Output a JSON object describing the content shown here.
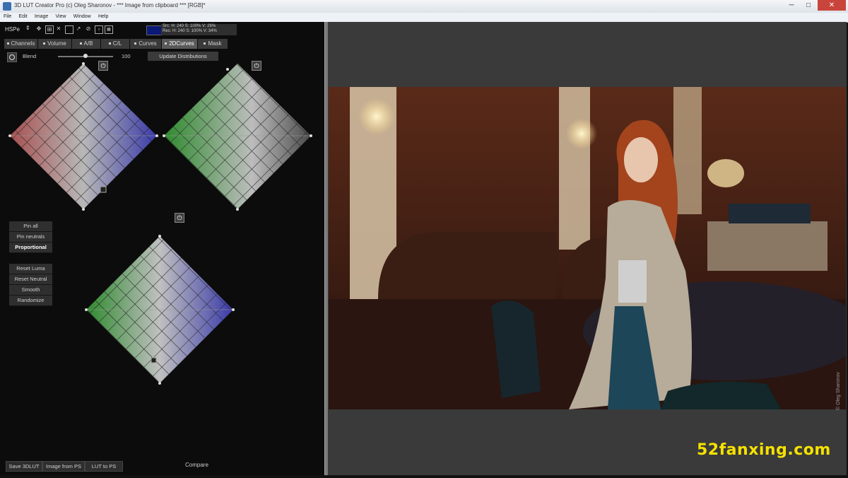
{
  "window": {
    "title": "3D LUT Creator Pro (c) Oleg Sharonov - *** Image from clipboard *** [RGB]*",
    "controls": {
      "minimize": "─",
      "maximize": "□",
      "close": "✕"
    }
  },
  "menu": [
    "File",
    "Edit",
    "Image",
    "View",
    "Window",
    "Help"
  ],
  "toolbar": {
    "mode": "HSPe",
    "readout_src": "Src: H: 240   S: 100%   V: 26%",
    "readout_res": "Res: H: 240   S: 100%   V: 34%"
  },
  "tabs": [
    {
      "label": "Channels"
    },
    {
      "label": "Volume"
    },
    {
      "label": "A/B"
    },
    {
      "label": "C/L"
    },
    {
      "label": "Curves"
    },
    {
      "label": "2DCurves",
      "active": true
    },
    {
      "label": "Mask"
    }
  ],
  "blend": {
    "label": "Blend",
    "value": "100",
    "fraction": 0.5
  },
  "update_button": "Update Distributions",
  "side_buttons": {
    "pin_all": "Pin all",
    "pin_neutrals": "Pin neutrals",
    "proportional": "Proportional",
    "reset_luma": "Reset Luma",
    "reset_neutral": "Reset Neutral",
    "smooth": "Smooth",
    "randomize": "Randomize"
  },
  "bottom": {
    "save": "Save 3DLUT",
    "image_from_ps": "Image from PS",
    "lut_to_ps": "LUT to PS",
    "compare": "Compare"
  },
  "power_icon": "⏻",
  "photo_credit": "© Oleg Sharonov",
  "watermark": "52fanxing.com",
  "colors": {
    "accent_swatch": "#0b1a78",
    "watermark": "#f5e100"
  }
}
